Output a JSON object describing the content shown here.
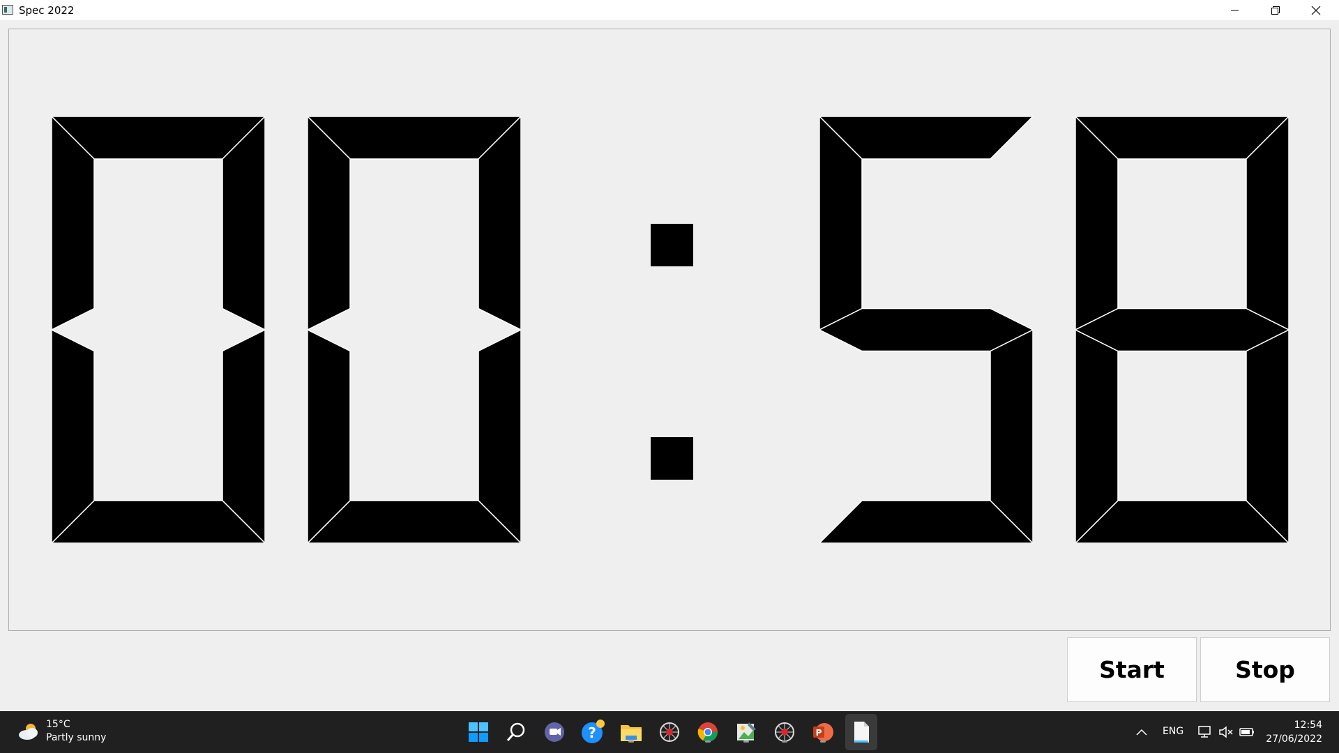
{
  "window": {
    "title": "Spec 2022",
    "controls": [
      "minimize-icon",
      "restore-icon",
      "close-icon"
    ]
  },
  "display": {
    "digits": [
      "0",
      "0",
      "5",
      "8"
    ],
    "separator": ":",
    "segment_color": "#000000",
    "background_color": "#efefef"
  },
  "buttons": {
    "start_label": "Start",
    "stop_label": "Stop"
  },
  "taskbar": {
    "weather": {
      "temperature": "15°C",
      "condition": "Partly sunny",
      "icon": "partly-sunny-icon"
    },
    "apps": [
      "windows-start-icon",
      "search-icon",
      "teams-chat-icon",
      "help-icon",
      "file-explorer-icon",
      "spider-app-icon",
      "chrome-icon",
      "image-editor-icon",
      "spider-app-icon-2",
      "powerpoint-icon",
      "document-icon"
    ],
    "language": "ENG",
    "time": "12:54",
    "date": "27/06/2022"
  }
}
